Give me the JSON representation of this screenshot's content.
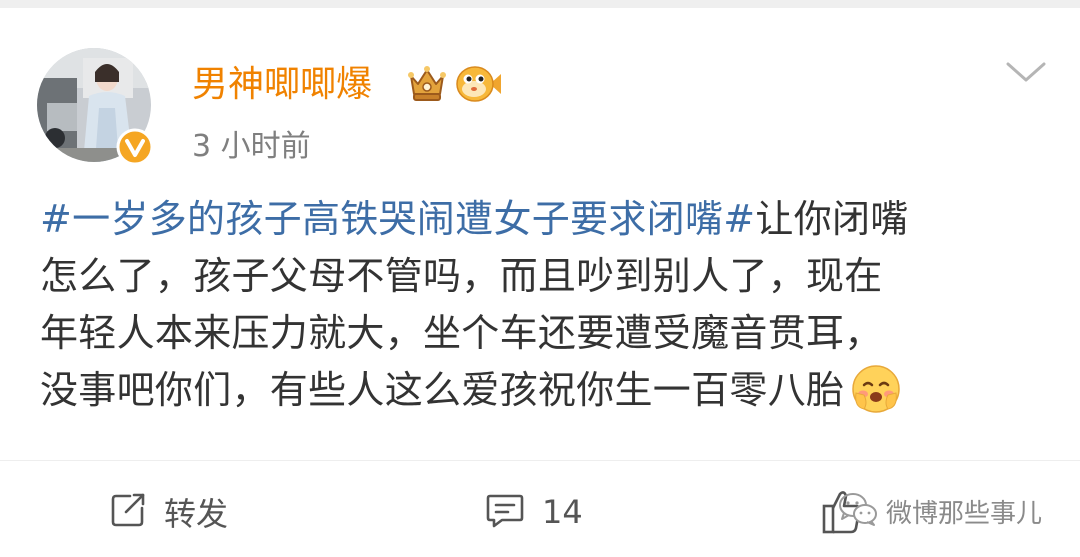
{
  "post": {
    "author": {
      "name": "男神唧唧爆",
      "badge_icon": "crown-badge-icon",
      "fan_icon": "puffer-fish-icon",
      "verified_icon": "verified-v-icon"
    },
    "timestamp": "3 小时前",
    "text": {
      "hashtag": "#一岁多的孩子高铁哭闹遭女子要求闭嘴#",
      "line1_rest": "让你闭嘴",
      "line2": "怎么了，孩子父母不管吗，而且吵到别人了，现在",
      "line3": "年轻人本来压力就大，坐个车还要遭受魔音贯耳，",
      "line4": "没事吧你们，有些人这么爱孩祝你生一百零八胎",
      "emoji": "blushing-face-emoji"
    },
    "actions": {
      "repost_label": "转发",
      "comment_count": "14"
    }
  },
  "watermark": {
    "text": "微博那些事儿"
  },
  "colors": {
    "username": "#f08200",
    "hashtag": "#3d6da6",
    "body_text": "#333333",
    "timestamp": "#7f7f7f",
    "verified": "#f5a623"
  }
}
